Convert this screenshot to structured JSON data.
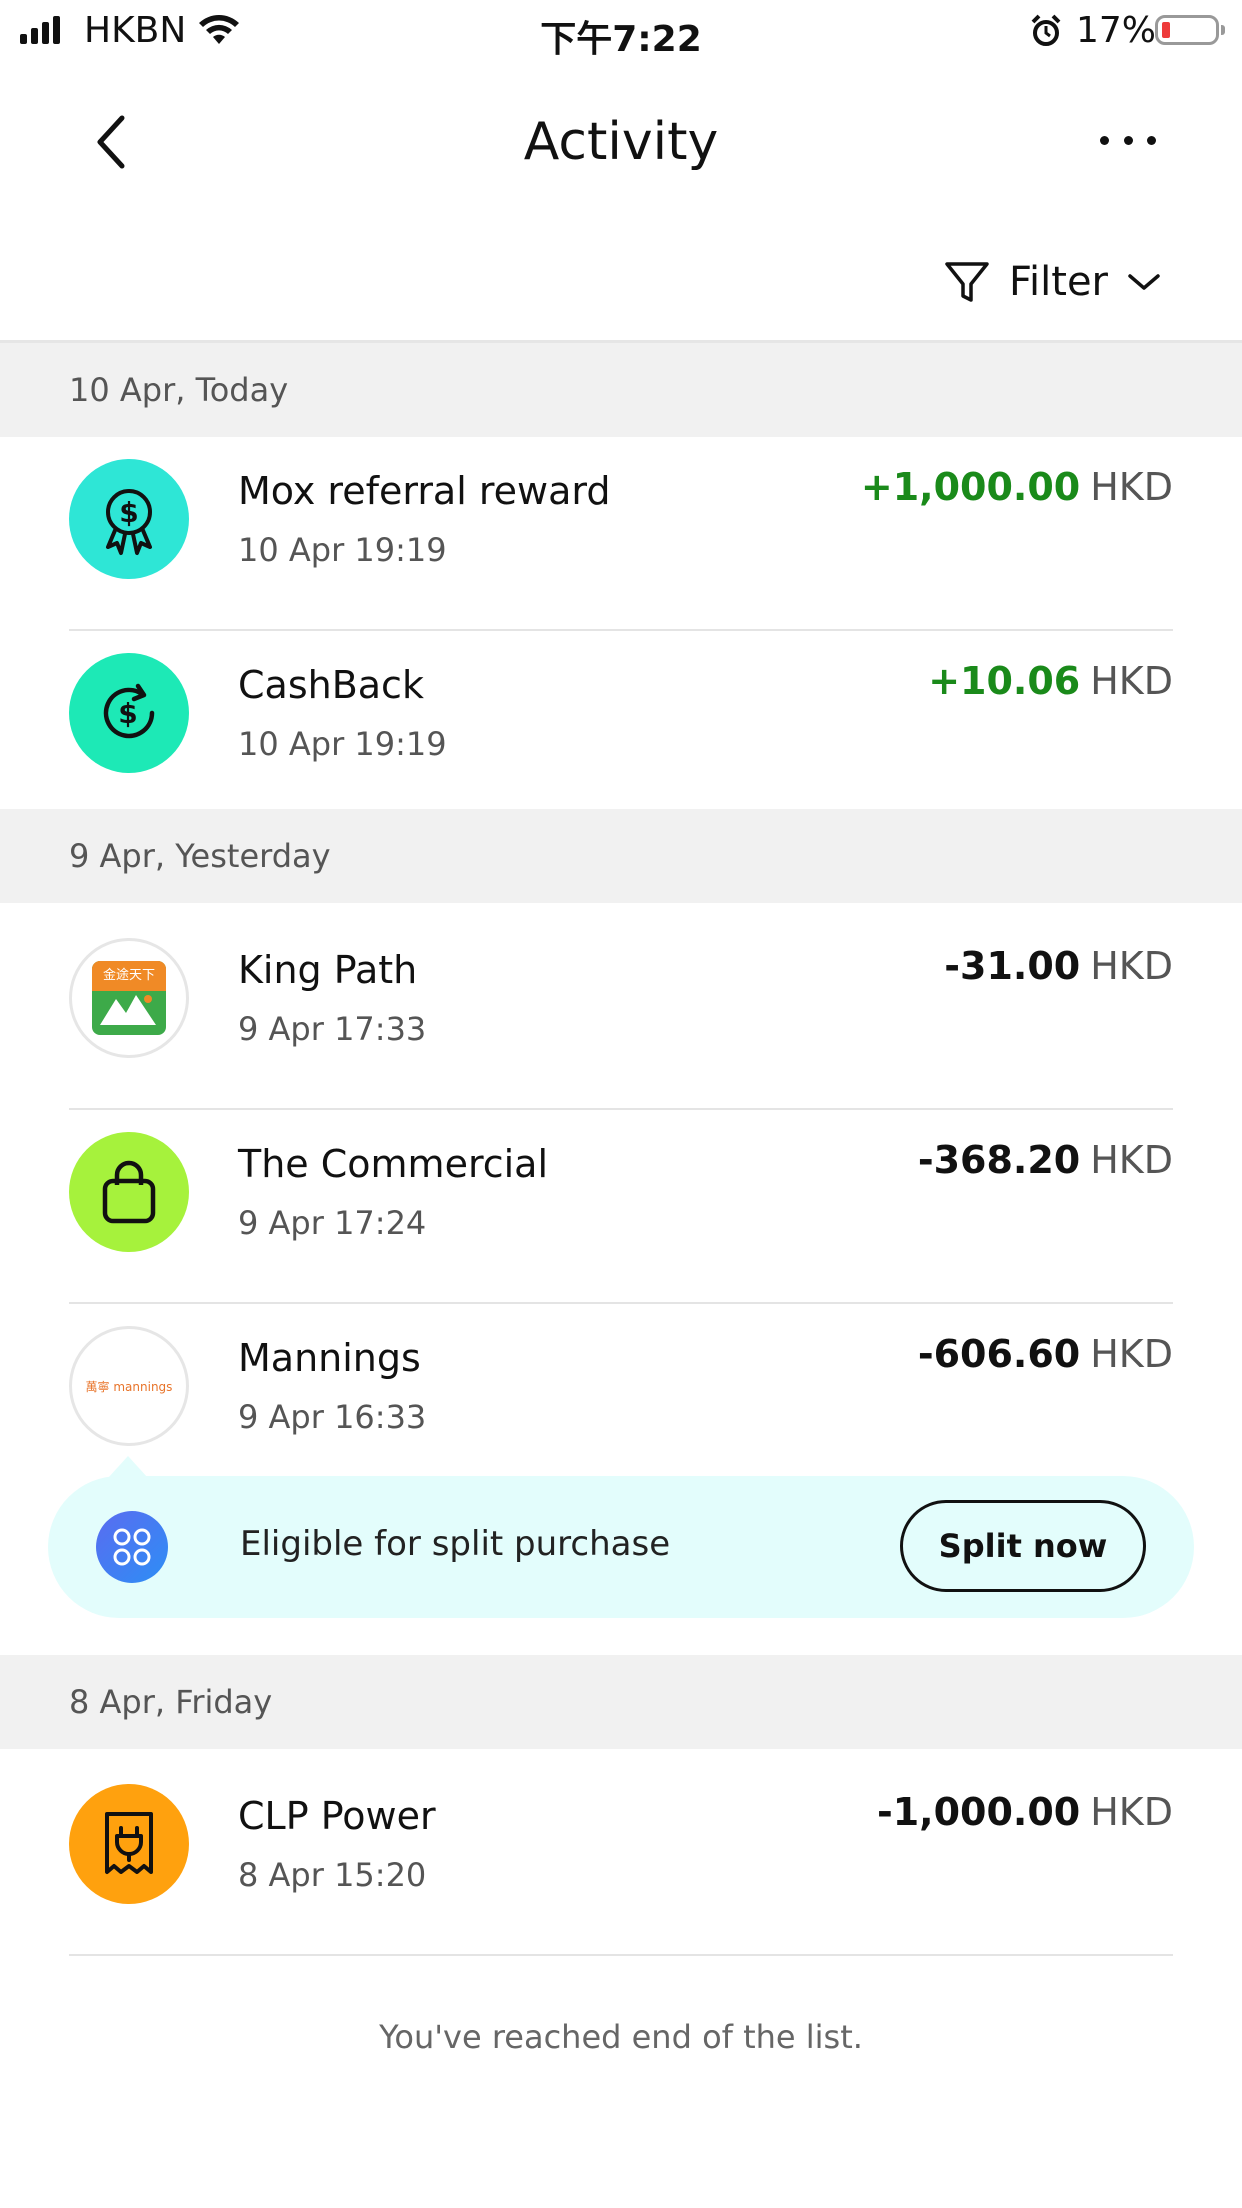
{
  "status_bar": {
    "carrier": "HKBN",
    "time": "下午7:22",
    "battery": "17%"
  },
  "header": {
    "title": "Activity",
    "filter_label": "Filter"
  },
  "sections": [
    {
      "label": "10 Apr, Today",
      "items": [
        {
          "name": "Mox referral reward",
          "time": "10 Apr 19:19",
          "amount": "+1,000.00",
          "currency": "HKD",
          "icon": "reward-badge-icon",
          "color": "#2ee6d6"
        },
        {
          "name": "CashBack",
          "time": "10 Apr 19:19",
          "amount": "+10.06",
          "currency": "HKD",
          "icon": "cashback-icon",
          "color": "#1de9b6"
        }
      ]
    },
    {
      "label": "9 Apr, Yesterday",
      "items": [
        {
          "name": "King Path",
          "time": "9 Apr 17:33",
          "amount": "-31.00",
          "currency": "HKD",
          "icon": "kingpath-logo",
          "color": "#ffffff"
        },
        {
          "name": "The Commercial",
          "time": "9 Apr 17:24",
          "amount": "-368.20",
          "currency": "HKD",
          "icon": "shopping-bag-icon",
          "color": "#a6f23c"
        },
        {
          "name": "Mannings",
          "time": "9 Apr 16:33",
          "amount": "-606.60",
          "currency": "HKD",
          "icon": "mannings-logo",
          "color": "#ffffff"
        }
      ]
    },
    {
      "label": "8 Apr, Friday",
      "items": [
        {
          "name": "CLP Power",
          "time": "8 Apr 15:20",
          "amount": "-1,000.00",
          "currency": "HKD",
          "icon": "bill-plug-icon",
          "color": "#ffa10e"
        }
      ]
    }
  ],
  "split_banner": {
    "text": "Eligible for split purchase",
    "button": "Split now"
  },
  "logos": {
    "mannings": "萬寧 mannings",
    "kingpath": "金途天下"
  },
  "footer": {
    "end_text": "You've reached end of the list."
  },
  "colors": {
    "positive": "#1a8a1a",
    "negative": "#111111",
    "section_bg": "#f1f1f1",
    "banner_bg": "#e3fdfc"
  }
}
